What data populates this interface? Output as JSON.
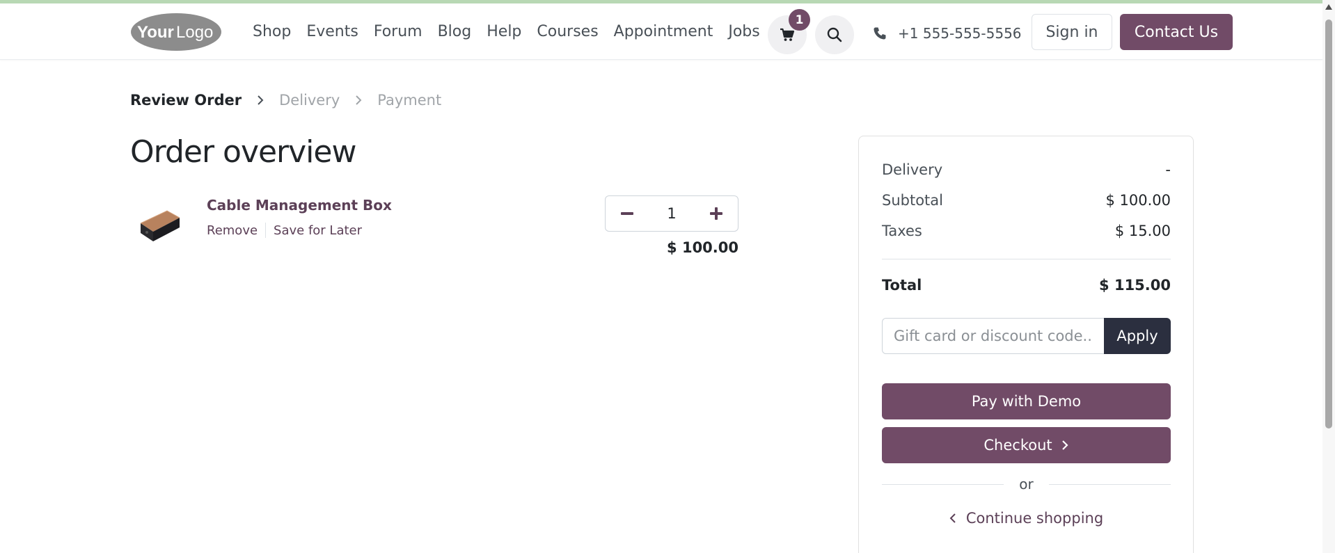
{
  "header": {
    "logo": {
      "text_main": "Your",
      "text_accent": "Logo"
    },
    "nav": [
      "Shop",
      "Events",
      "Forum",
      "Blog",
      "Help",
      "Courses",
      "Appointment",
      "Jobs"
    ],
    "cart_count": "1",
    "phone": "+1 555-555-5556",
    "signin_label": "Sign in",
    "contact_label": "Contact Us",
    "icons": {
      "cart": "cart-icon",
      "search": "search-icon",
      "phone": "phone-icon"
    }
  },
  "breadcrumb": {
    "active": "Review Order",
    "steps": [
      "Delivery",
      "Payment"
    ]
  },
  "page_title": "Order overview",
  "cart_line": {
    "product_name": "Cable Management Box",
    "remove_label": "Remove",
    "save_label": "Save for Later",
    "quantity": "1",
    "price": "$ 100.00"
  },
  "summary": {
    "delivery_label": "Delivery",
    "delivery_value": "-",
    "subtotal_label": "Subtotal",
    "subtotal_value": "$ 100.00",
    "taxes_label": "Taxes",
    "taxes_value": "$ 15.00",
    "total_label": "Total",
    "total_value": "$ 115.00",
    "discount_placeholder": "Gift card or discount code...",
    "apply_label": "Apply",
    "pay_demo_label": "Pay with Demo",
    "checkout_label": "Checkout",
    "or_label": "or",
    "continue_label": "Continue shopping"
  },
  "colors": {
    "brand": "#714b67",
    "dark_button": "#2b2f3f",
    "top_accent": "#b8d8b4"
  }
}
